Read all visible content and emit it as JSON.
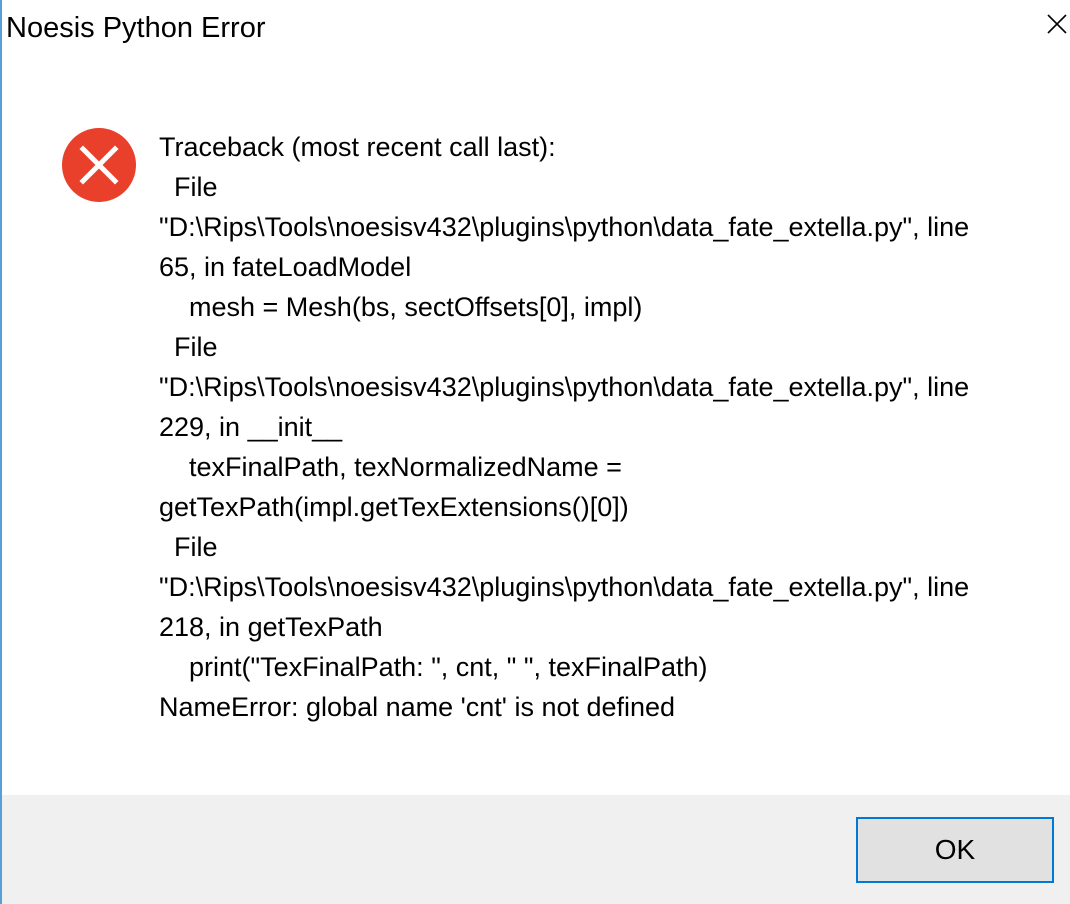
{
  "window": {
    "title": "Noesis Python Error",
    "close_icon": "close-icon"
  },
  "message": {
    "icon": "error-icon",
    "icon_color": "#e8402a",
    "lines": [
      "Traceback (most recent call last):",
      "  File",
      "\"D:\\Rips\\Tools\\noesisv432\\plugins\\python\\data_fate_extella.py\", line",
      "65, in fateLoadModel",
      "    mesh = Mesh(bs, sectOffsets[0], impl)",
      "  File",
      "\"D:\\Rips\\Tools\\noesisv432\\plugins\\python\\data_fate_extella.py\", line",
      "229, in __init__",
      "    texFinalPath, texNormalizedName =",
      "getTexPath(impl.getTexExtensions()[0])",
      "  File",
      "\"D:\\Rips\\Tools\\noesisv432\\plugins\\python\\data_fate_extella.py\", line",
      "218, in getTexPath",
      "    print(\"TexFinalPath: \", cnt, \" \", texFinalPath)",
      "NameError: global name 'cnt' is not defined"
    ]
  },
  "footer": {
    "ok_label": "OK"
  },
  "colors": {
    "footer_bg": "#f0f0f0",
    "button_border": "#0078d7",
    "button_bg": "#e1e1e1"
  }
}
